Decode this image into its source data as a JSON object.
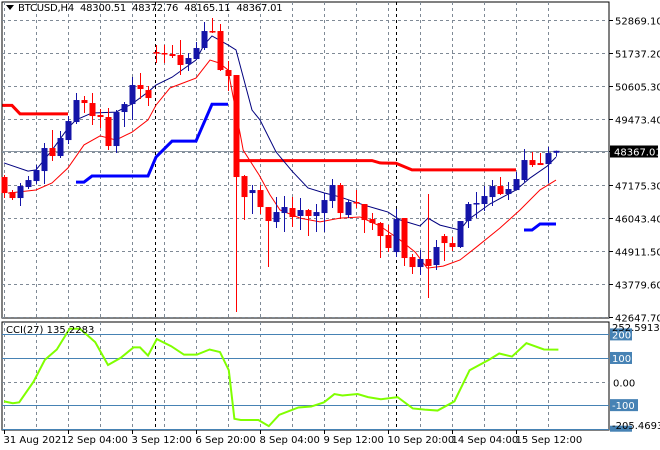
{
  "header": {
    "symbol": "BTCUSD,H4",
    "open": "48300.51",
    "high": "48372.76",
    "low": "48165.11",
    "close": "48367.01"
  },
  "cci_header": {
    "name": "CCI(27)",
    "value": "135.2283"
  },
  "colors": {
    "bull": "#1414a8",
    "bear": "#ff0000",
    "grid": "#7f8a96",
    "ma_slow": "#00007f",
    "ma_fast": "#ff0000",
    "resistance": "#ff0000",
    "support": "#0000ff",
    "cci": "#80ff00",
    "level": "#4682b4",
    "price_box": "#000000"
  },
  "chart_data": [
    {
      "type": "candlestick",
      "title": "BTCUSD,H4",
      "ylim": [
        42613,
        53489
      ],
      "y_ticks": [
        "52869.10",
        "51737.20",
        "50605.30",
        "49473.40",
        "48367.01",
        "47175.30",
        "46043.40",
        "44911.50",
        "43779.60",
        "42647.70"
      ],
      "y_tick_values": [
        52869.1,
        51737.2,
        50605.3,
        49473.4,
        48367.01,
        47175.3,
        46043.4,
        44911.5,
        43779.6,
        42647.7
      ],
      "grid_values": [
        52869.1,
        51737.2,
        50605.3,
        49473.4,
        48341.5,
        47175.3,
        46043.4,
        44911.5,
        43779.6,
        42647.7
      ],
      "current_price": "48367.01",
      "x_labels": [
        {
          "bar": 0,
          "text": "31 Aug 2021"
        },
        {
          "bar": 8,
          "text": "2 Sep 04:00"
        },
        {
          "bar": 16,
          "text": "3 Sep 12:00"
        },
        {
          "bar": 24,
          "text": "6 Sep 20:00"
        },
        {
          "bar": 32,
          "text": "8 Sep 04:00"
        },
        {
          "bar": 40,
          "text": "9 Sep 12:00"
        },
        {
          "bar": 48,
          "text": "10 Sep 20:00"
        },
        {
          "bar": 56,
          "text": "14 Sep 04:00"
        },
        {
          "bar": 64,
          "text": "15 Sep 12:00"
        }
      ],
      "separators": [
        18.9,
        49
      ],
      "ohlc": [
        [
          47465,
          47534,
          46742,
          46914
        ],
        [
          46948,
          47017,
          46673,
          46742
        ],
        [
          46742,
          47258,
          46467,
          47155
        ],
        [
          47121,
          47499,
          47052,
          47361
        ],
        [
          47327,
          47878,
          47224,
          47706
        ],
        [
          47671,
          48635,
          47224,
          48463
        ],
        [
          48463,
          49082,
          48016,
          48188
        ],
        [
          48188,
          49048,
          48119,
          48807
        ],
        [
          48738,
          49564,
          48601,
          49392
        ],
        [
          49358,
          50356,
          49289,
          50115
        ],
        [
          50115,
          50253,
          49668,
          50012
        ],
        [
          50012,
          50356,
          49255,
          49564
        ],
        [
          49599,
          49805,
          49151,
          49530
        ],
        [
          49530,
          49840,
          48394,
          48532
        ],
        [
          48532,
          49771,
          48291,
          49702
        ],
        [
          49702,
          50046,
          49186,
          49977
        ],
        [
          49977,
          50907,
          49427,
          50631
        ],
        [
          50631,
          51044,
          50150,
          50494
        ],
        [
          50459,
          50597,
          49909,
          50184
        ],
        [
          51767,
          52008,
          51389,
          51733
        ],
        [
          51733,
          52008,
          51389,
          51698
        ],
        [
          51698,
          52008,
          51561,
          51630
        ],
        [
          51664,
          52180,
          50976,
          51320
        ],
        [
          51354,
          51733,
          51113,
          51561
        ],
        [
          51526,
          52111,
          51492,
          51905
        ],
        [
          51905,
          52800,
          51836,
          52490
        ],
        [
          52490,
          52937,
          52421,
          52456
        ],
        [
          52490,
          52731,
          51113,
          51148
        ],
        [
          51148,
          51457,
          50425,
          50941
        ],
        [
          50976,
          50976,
          42818,
          47465
        ],
        [
          47499,
          47534,
          45985,
          46776
        ],
        [
          46914,
          47189,
          46191,
          47017
        ],
        [
          47017,
          47189,
          46191,
          46432
        ],
        [
          46432,
          46432,
          44367,
          45951
        ],
        [
          45916,
          46776,
          45709,
          46260
        ],
        [
          46226,
          46811,
          45572,
          46432
        ],
        [
          46398,
          46776,
          45744,
          46088
        ],
        [
          46123,
          46742,
          45641,
          46329
        ],
        [
          46329,
          46364,
          45434,
          46123
        ],
        [
          46123,
          46536,
          45572,
          46260
        ],
        [
          46226,
          46914,
          45572,
          46673
        ],
        [
          46639,
          47396,
          46398,
          47189
        ],
        [
          47189,
          47258,
          46019,
          46226
        ],
        [
          46157,
          46673,
          46054,
          46604
        ],
        [
          46604,
          47017,
          46398,
          46570
        ],
        [
          46536,
          46536,
          45537,
          45985
        ],
        [
          46019,
          46226,
          45641,
          45882
        ],
        [
          45882,
          45916,
          44677,
          45434
        ],
        [
          45469,
          45813,
          44883,
          45021
        ],
        [
          44883,
          46364,
          44711,
          46019
        ],
        [
          46054,
          46054,
          44402,
          44677
        ],
        [
          44711,
          44814,
          44126,
          44367
        ],
        [
          44367,
          44952,
          44092,
          44643
        ],
        [
          44643,
          46880,
          43300,
          44402
        ],
        [
          44436,
          45296,
          44264,
          45056
        ],
        [
          45434,
          45503,
          44574,
          45193
        ],
        [
          45193,
          45400,
          44918,
          45056
        ],
        [
          45056,
          45951,
          45021,
          45951
        ],
        [
          45951,
          46604,
          45709,
          46536
        ],
        [
          46536,
          46948,
          46054,
          46570
        ],
        [
          46536,
          47155,
          46295,
          46811
        ],
        [
          46776,
          47361,
          46467,
          47155
        ],
        [
          47155,
          47465,
          46845,
          46880
        ],
        [
          46880,
          47293,
          46673,
          47052
        ],
        [
          47017,
          47637,
          47017,
          47396
        ],
        [
          47361,
          48429,
          47293,
          48050
        ],
        [
          48050,
          48325,
          47809,
          47878
        ],
        [
          47946,
          48291,
          47878,
          47878
        ],
        [
          47912,
          48497,
          47258,
          48291
        ],
        [
          48300.51,
          48372.76,
          48165.11,
          48367.01
        ]
      ],
      "ma_slow": [
        [
          0,
          47950
        ],
        [
          3,
          47670
        ],
        [
          4,
          47710
        ],
        [
          6,
          48390
        ],
        [
          8,
          49150
        ],
        [
          9,
          49430
        ],
        [
          11,
          49670
        ],
        [
          14,
          49700
        ],
        [
          16,
          49980
        ],
        [
          18,
          50390
        ],
        [
          19,
          50630
        ],
        [
          21,
          50900
        ],
        [
          24,
          51490
        ],
        [
          25,
          52010
        ],
        [
          26,
          52320
        ],
        [
          28,
          52010
        ],
        [
          29,
          51840
        ],
        [
          31,
          49770
        ],
        [
          32,
          49430
        ],
        [
          34,
          48330
        ],
        [
          36,
          47670
        ],
        [
          38,
          47090
        ],
        [
          40,
          46920
        ],
        [
          42,
          46780
        ],
        [
          45,
          46500
        ],
        [
          48,
          46260
        ],
        [
          49.5,
          45990
        ],
        [
          52,
          45780
        ],
        [
          53,
          46050
        ],
        [
          54.5,
          45810
        ],
        [
          57,
          45640
        ],
        [
          58,
          45990
        ],
        [
          60.75,
          46540
        ],
        [
          64,
          47020
        ],
        [
          65.75,
          47430
        ],
        [
          67.9,
          47840
        ],
        [
          69,
          48150
        ]
      ],
      "ma_fast": [
        [
          0.5,
          46910
        ],
        [
          4,
          47020
        ],
        [
          6,
          47260
        ],
        [
          8,
          47780
        ],
        [
          10,
          48570
        ],
        [
          12,
          48880
        ],
        [
          14,
          48740
        ],
        [
          16,
          49010
        ],
        [
          18,
          49430
        ],
        [
          19,
          49940
        ],
        [
          20.75,
          50530
        ],
        [
          24,
          50870
        ],
        [
          25.75,
          51490
        ],
        [
          26.9,
          51390
        ],
        [
          28,
          51150
        ],
        [
          29.5,
          48980
        ],
        [
          29.9,
          48390
        ],
        [
          31.9,
          47530
        ],
        [
          33.25,
          46850
        ],
        [
          34.5,
          46330
        ],
        [
          37,
          46050
        ],
        [
          39.5,
          45920
        ],
        [
          42,
          46050
        ],
        [
          44.5,
          46090
        ],
        [
          47,
          45780
        ],
        [
          49.5,
          45300
        ],
        [
          51.4,
          44880
        ],
        [
          52.9,
          44330
        ],
        [
          54.9,
          44400
        ],
        [
          57,
          44610
        ],
        [
          58.9,
          45020
        ],
        [
          62,
          45710
        ],
        [
          64.5,
          46330
        ],
        [
          67,
          47020
        ],
        [
          69,
          47360
        ]
      ],
      "resistance": [
        [
          [
            -0.2,
            49930
          ],
          [
            1,
            49930
          ],
          [
            2,
            49640
          ],
          [
            8,
            49640
          ]
        ],
        [
          [
            29,
            48030
          ],
          [
            46,
            48030
          ],
          [
            47,
            47950
          ],
          [
            49,
            47940
          ],
          [
            51,
            47710
          ],
          [
            64,
            47710
          ]
        ]
      ],
      "support": [
        [
          [
            9,
            47290
          ],
          [
            10,
            47290
          ],
          [
            11,
            47500
          ],
          [
            18,
            47500
          ],
          [
            19,
            48150
          ],
          [
            21,
            48700
          ],
          [
            24,
            48700
          ],
          [
            26,
            49970
          ],
          [
            28,
            49970
          ]
        ],
        [
          [
            65,
            45640
          ],
          [
            66,
            45640
          ],
          [
            67,
            45850
          ],
          [
            69,
            45850
          ]
        ]
      ]
    },
    {
      "type": "line",
      "title": "CCI(27)",
      "ylim": [
        -205.4693,
        252.5913
      ],
      "y_ticks": [
        "252.5913",
        "200",
        "100",
        "0.00",
        "-100",
        "-205.4693"
      ],
      "levels": [
        200,
        100,
        -100,
        -200
      ],
      "level_labels": [
        "200",
        "100",
        "-100"
      ],
      "zero_label": "0.00",
      "top_label": "252.5913",
      "bottom_label": "-205.4693",
      "series": [
        [
          0,
          -84
        ],
        [
          1.1,
          -92
        ],
        [
          1.9,
          -88
        ],
        [
          3.7,
          0
        ],
        [
          5.1,
          92
        ],
        [
          6.6,
          136
        ],
        [
          8.2,
          224
        ],
        [
          9.5,
          224
        ],
        [
          11.4,
          167
        ],
        [
          13,
          70
        ],
        [
          14.6,
          101
        ],
        [
          16.2,
          145
        ],
        [
          17,
          145
        ],
        [
          18,
          110
        ],
        [
          19.1,
          180
        ],
        [
          20.9,
          150
        ],
        [
          22.5,
          114
        ],
        [
          24.1,
          114
        ],
        [
          25.7,
          136
        ],
        [
          27,
          125
        ],
        [
          28.1,
          48
        ],
        [
          28.8,
          -158
        ],
        [
          29.6,
          -163
        ],
        [
          31.8,
          -163
        ],
        [
          33.1,
          -189
        ],
        [
          34.4,
          -141
        ],
        [
          36.8,
          -110
        ],
        [
          38.4,
          -106
        ],
        [
          40,
          -88
        ],
        [
          41.3,
          -53
        ],
        [
          42.3,
          -59
        ],
        [
          44.2,
          -53
        ],
        [
          45.5,
          -66
        ],
        [
          47.1,
          -75
        ],
        [
          49.2,
          -66
        ],
        [
          51.1,
          -114
        ],
        [
          52.6,
          -119
        ],
        [
          54.2,
          -123
        ],
        [
          56.3,
          -84
        ],
        [
          58.2,
          48
        ],
        [
          60.6,
          92
        ],
        [
          61.9,
          119
        ],
        [
          63.5,
          106
        ],
        [
          65.3,
          163
        ],
        [
          67.5,
          136
        ],
        [
          69.3,
          135.2
        ]
      ]
    }
  ]
}
